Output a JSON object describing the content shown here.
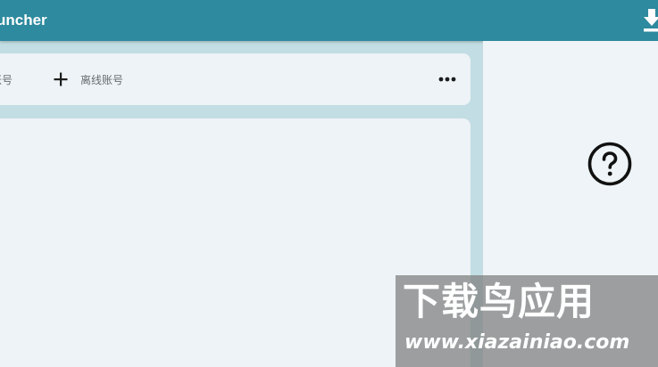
{
  "titlebar": {
    "title": "uncher",
    "download_icon": "download-icon"
  },
  "accounts_toolbar": {
    "first_item_label": "账号",
    "add_offline_label": "离线账号",
    "add_icon": "plus-icon",
    "more_icon": "more-horizontal-icon"
  },
  "side_panel": {
    "help_icon": "help-circle-icon"
  },
  "watermark": {
    "title": "下载鸟应用",
    "url": "www.xiazainiao.com"
  },
  "colors": {
    "titlebar": "#2e8a9e",
    "background": "#c2dde3",
    "card": "#edf3f6",
    "icon": "#1c1c1c",
    "label": "#666d71"
  }
}
